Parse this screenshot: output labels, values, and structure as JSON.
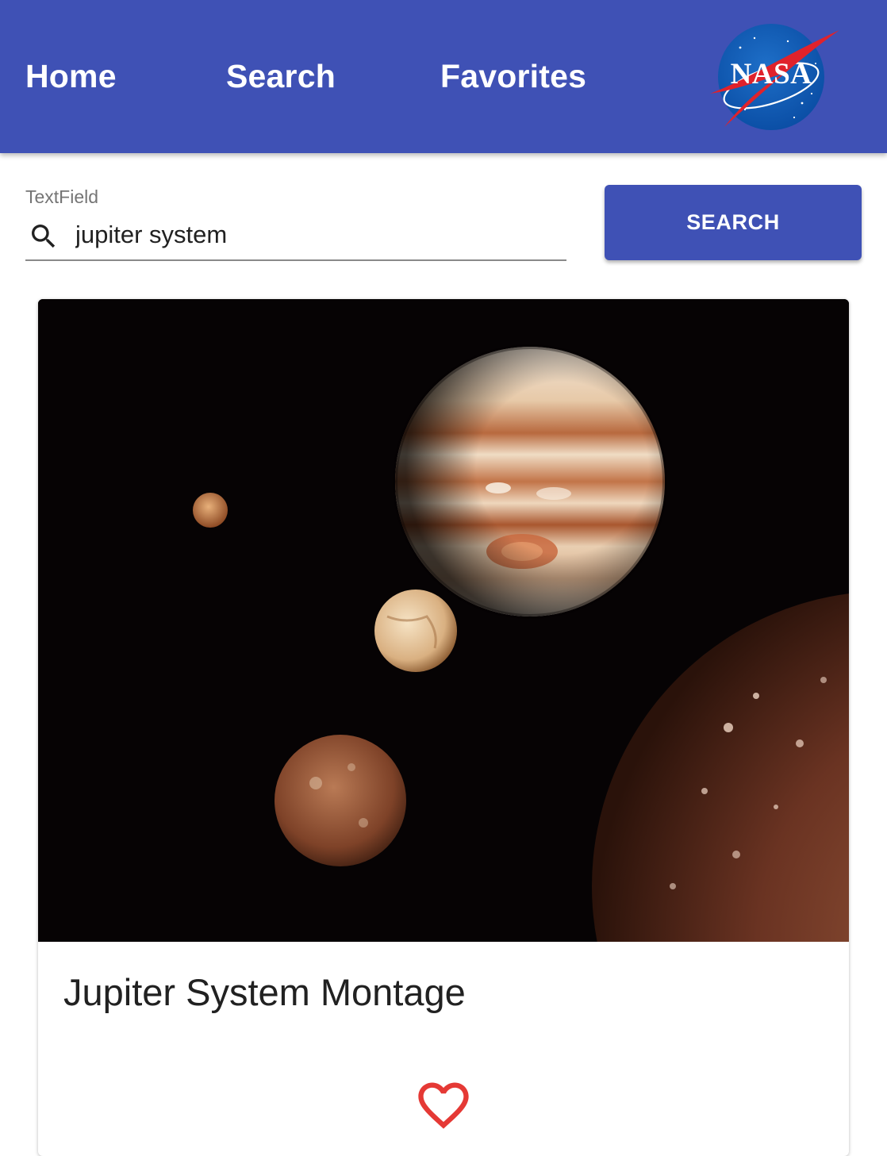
{
  "header": {
    "nav": {
      "home": "Home",
      "search": "Search",
      "favorites": "Favorites"
    },
    "logo_text": "NASA",
    "background_color": "#3f51b5"
  },
  "search": {
    "label": "TextField",
    "value": "jupiter system",
    "icon": "search-icon",
    "button_label": "SEARCH"
  },
  "results": [
    {
      "title": "Jupiter System Montage",
      "favorite_icon": "heart-outline-icon",
      "favorite_color": "#e53935"
    }
  ]
}
